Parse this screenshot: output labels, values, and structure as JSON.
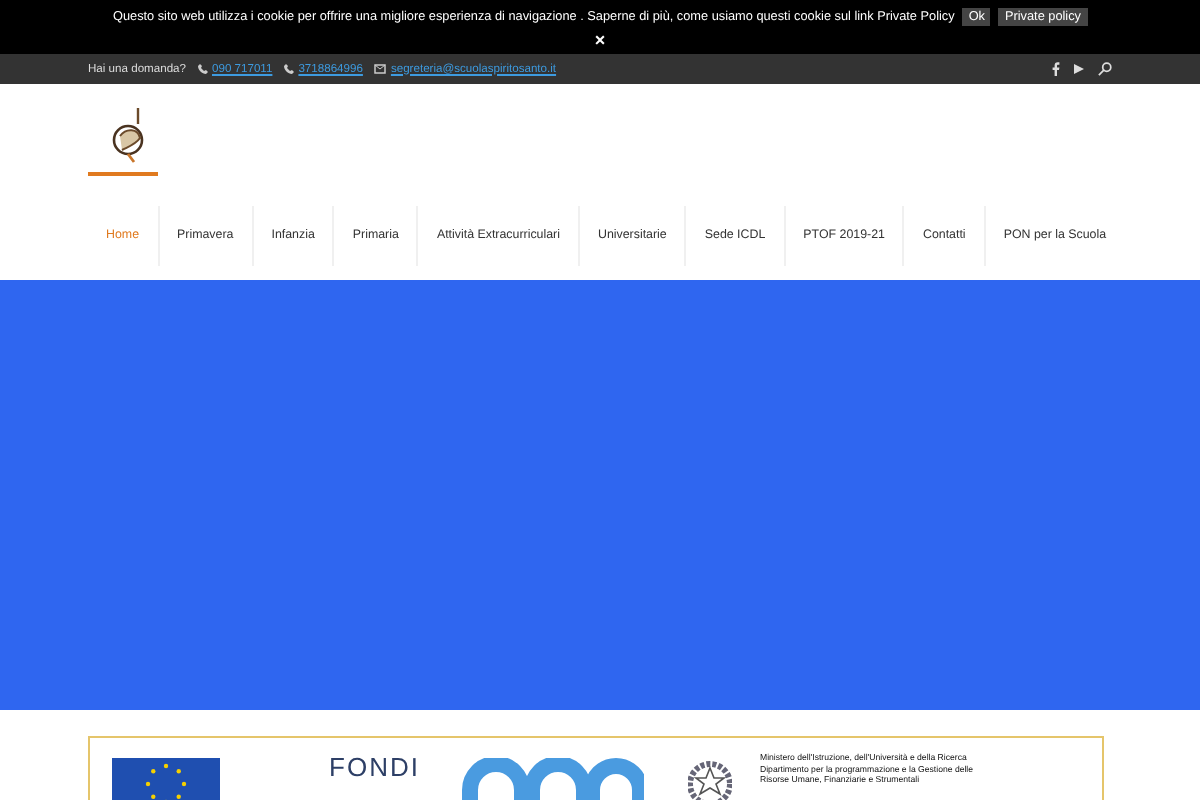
{
  "cookie_bar": {
    "message": "Questo sito web utilizza i cookie per offrire una migliore esperienza di navigazione . Saperne di più, come usiamo questi cookie sul link Private Policy",
    "buttons": [
      "Ok",
      "Private policy"
    ],
    "close": "×"
  },
  "top_bar": {
    "question": "Hai una domanda?",
    "contacts": [
      {
        "kind": "phone",
        "text": "090 717011"
      },
      {
        "kind": "phone",
        "text": "3718864996"
      },
      {
        "kind": "email",
        "text": "segreteria@scuolaspiritosanto.it"
      }
    ]
  },
  "nav": [
    {
      "label": "Home",
      "selected": true
    },
    {
      "label": "Primavera",
      "selected": false
    },
    {
      "label": "Infanzia",
      "selected": false
    },
    {
      "label": "Primaria",
      "selected": false
    },
    {
      "label": "Attività Extracurriculari",
      "selected": false
    },
    {
      "label": "Universitarie",
      "selected": false
    },
    {
      "label": "Sede ICDL",
      "selected": false
    },
    {
      "label": "PTOF 2019-21",
      "selected": false
    },
    {
      "label": "Contatti",
      "selected": false
    },
    {
      "label": "PON per la Scuola",
      "selected": false
    }
  ],
  "banner": {
    "fondi": "FONDI",
    "ministry": [
      "Ministero dell'Istruzione, dell'Università e della Ricerca",
      "Dipartimento per la programmazione e la Gestione delle",
      "Risorse Umane, Finanziarie e Strumentali"
    ]
  }
}
